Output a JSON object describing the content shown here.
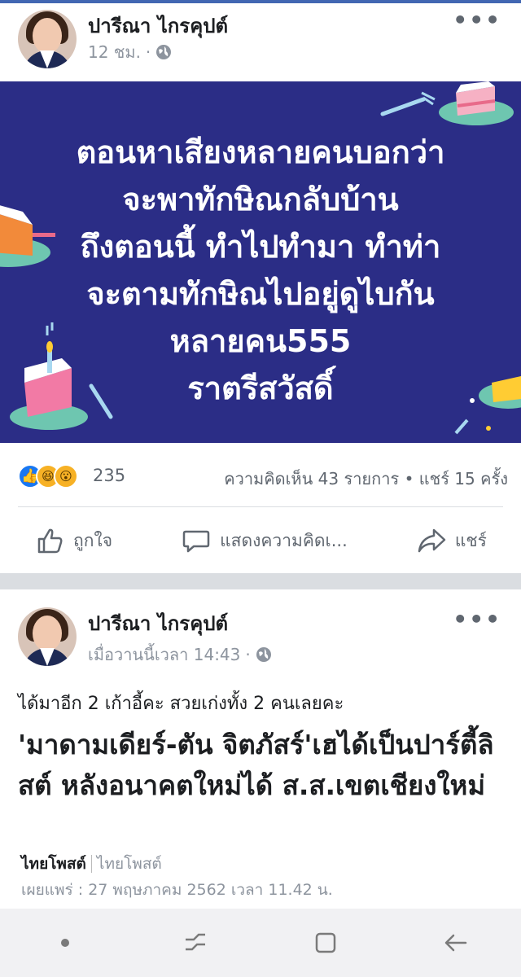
{
  "post1": {
    "author": "ปารีณา ไกรคุปต์",
    "time": "12 ชม.",
    "privacy_icon": "globe-icon",
    "menu_icon": "more-dots-icon",
    "banner": {
      "bg_color": "#2b2d86",
      "lines": [
        "ตอนหาเสียงหลายคนบอกว่า",
        "จะพาทักษิณกลับบ้าน",
        "ถึงตอนนี้ ทำไปทำมา ทำท่า",
        "จะตามทักษิณไปอยู่ดูไบกัน",
        "หลายคน555",
        "ราตรีสวัสดิ์"
      ]
    },
    "reactions": {
      "icons": [
        "like-icon",
        "haha-icon",
        "wow-icon"
      ],
      "count": "235"
    },
    "stats": "ความคิดเห็น 43 รายการ • แชร์ 15 ครั้ง",
    "actions": {
      "like": "ถูกใจ",
      "comment": "แสดงความคิดเ...",
      "share": "แชร์"
    }
  },
  "post2": {
    "author": "ปารีณา ไกรคุปต์",
    "time": "เมื่อวานนี้เวลา 14:43",
    "privacy_icon": "globe-icon",
    "menu_icon": "more-dots-icon",
    "caption": "ได้มาอีก 2 เก้าอี้คะ สวยเก่งทั้ง 2 คนเลยคะ",
    "headline": "'มาดามเดียร์-ตัน จิตภัสร์'เฮได้เป็นปาร์ตี้ลิสต์ หลังอนาคตใหม่ได้ ส.ส.เขตเชียงใหม่",
    "source_name": "ไทยโพสต์",
    "source_logo_text": "ไทยโพสต์",
    "published": "เผยแพร่ : 27 พฤษภาคม 2562 เวลา 11.42 น."
  },
  "navbar": {
    "icons": [
      "dot-icon",
      "recent-apps-icon",
      "home-icon",
      "back-icon"
    ]
  },
  "colors": {
    "accent": "#4267b2",
    "like_blue": "#1877f2",
    "muted_text": "#8d949e"
  }
}
